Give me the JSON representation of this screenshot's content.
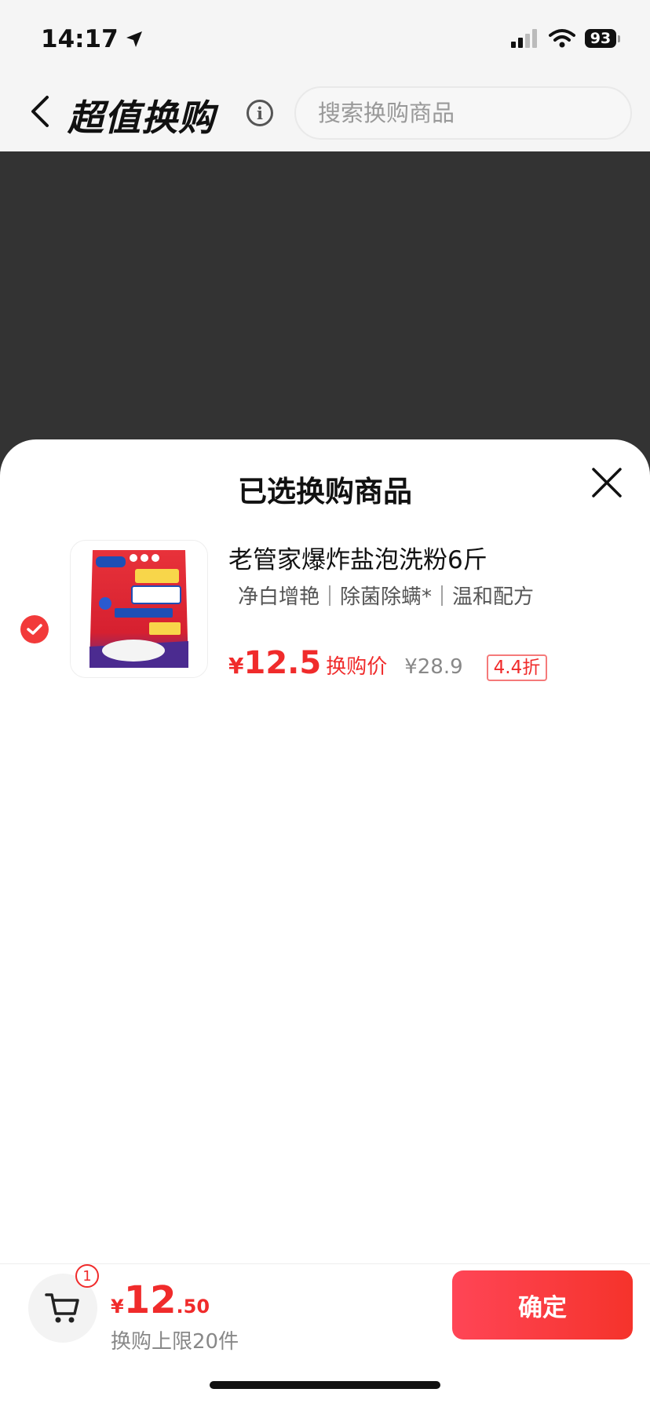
{
  "status_bar": {
    "time": "14:17",
    "battery": "93"
  },
  "header": {
    "title": "超值换购",
    "search_placeholder": "搜索换购商品"
  },
  "sheet": {
    "title": "已选换购商品",
    "item": {
      "name": "老管家爆炸盐泡洗粉6斤",
      "tags": "净白增艳｜除菌除螨*｜温和配方",
      "currency": "¥",
      "price": "12.5",
      "price_label": "换购价",
      "original_price": "¥28.9",
      "discount": "4.4折",
      "selected": true
    }
  },
  "bottom_bar": {
    "cart_count": "1",
    "currency": "¥",
    "total_int": "12",
    "total_dec": ".50",
    "limit_text": "换购上限20件",
    "confirm_label": "确定"
  },
  "colors": {
    "accent": "#f02b2b",
    "overlay": "#333333"
  },
  "icons": [
    "back-icon",
    "info-icon",
    "close-icon",
    "check-icon",
    "cart-icon",
    "location-arrow-icon",
    "signal-icon",
    "wifi-icon"
  ]
}
